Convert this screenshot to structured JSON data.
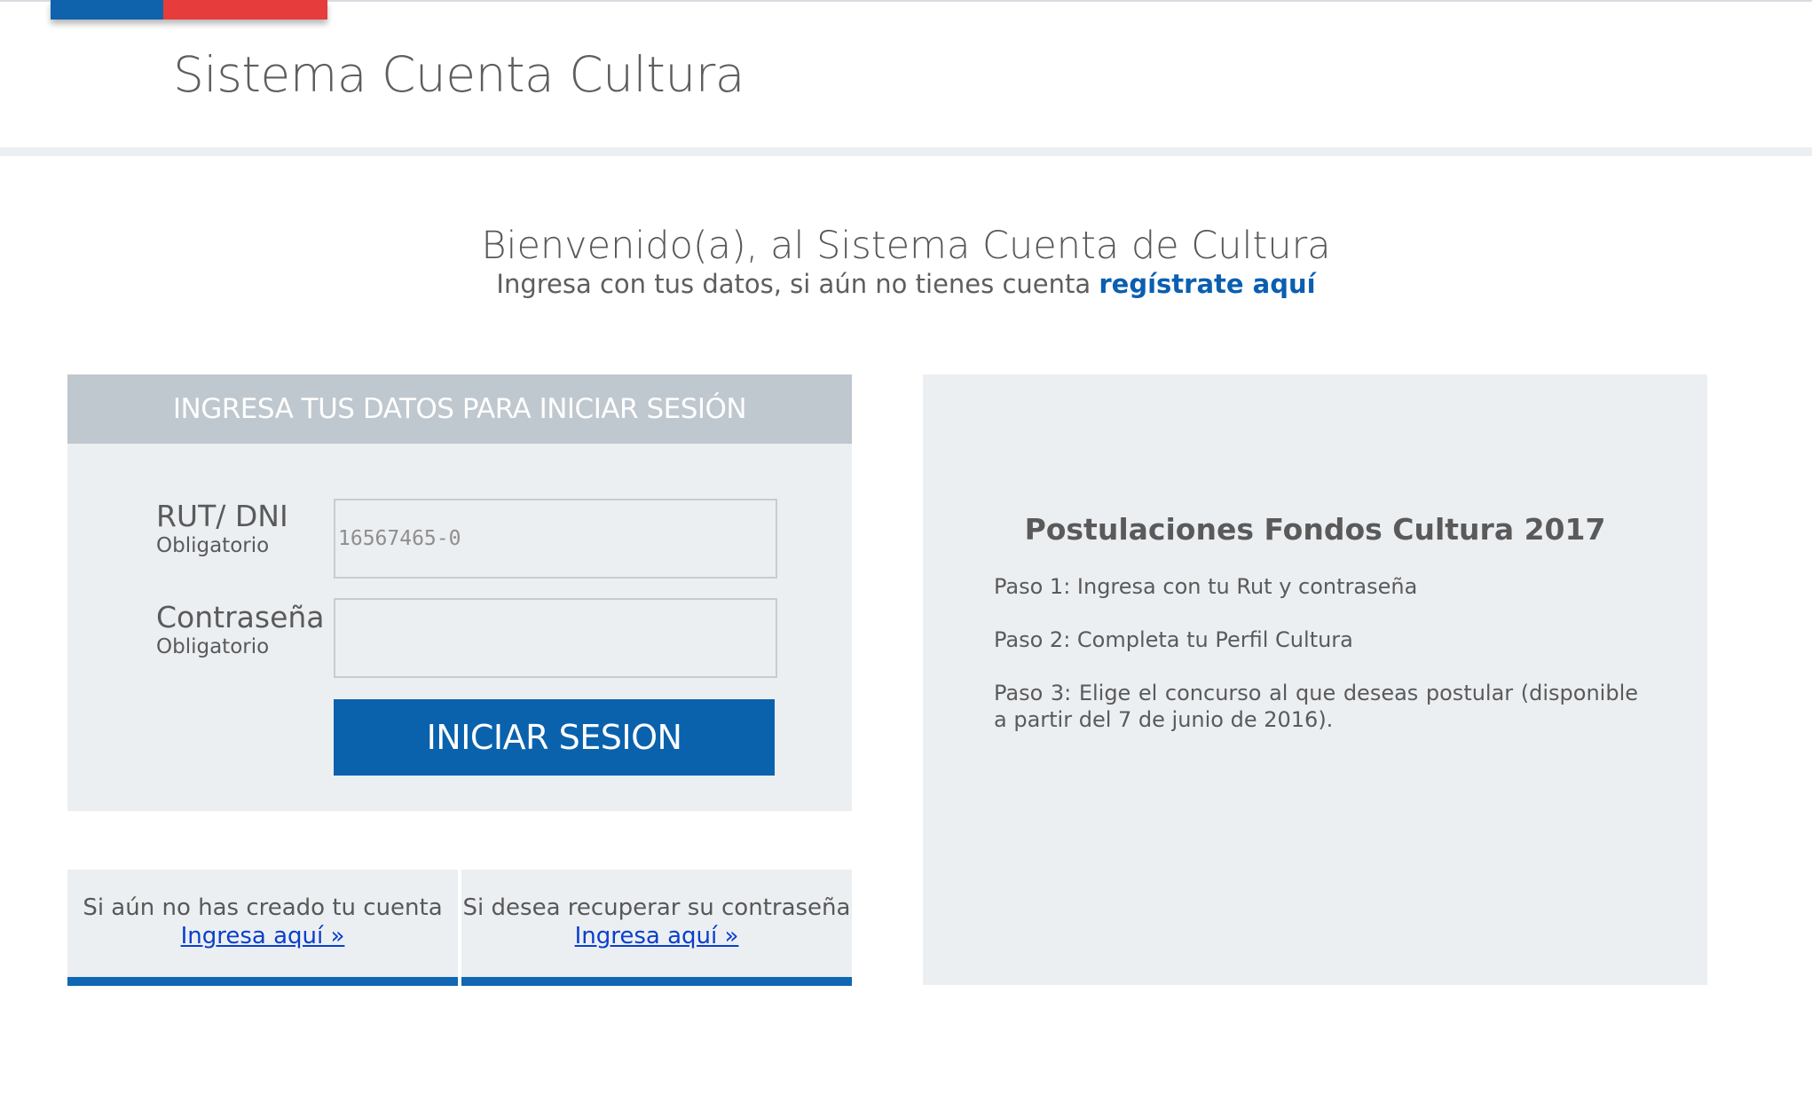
{
  "header": {
    "site_title": "Sistema Cuenta Cultura",
    "flag_colors": {
      "blue": "#0f62ac",
      "red": "#e63c3c"
    }
  },
  "welcome": {
    "title": "Bienvenido(a), al Sistema Cuenta de Cultura",
    "subtitle": "Ingresa con tus datos, si aún no tienes cuenta",
    "register_link": "regístrate aquí"
  },
  "login": {
    "header": "INGRESA TUS DATOS PARA INICIAR SESIÓN",
    "rut_label": "RUT/ DNI",
    "rut_required": "Obligatorio",
    "rut_placeholder": "16567465-0",
    "rut_value": "",
    "password_label": "Contraseña",
    "password_required": "Obligatorio",
    "password_value": "",
    "submit_label": "INICIAR SESION",
    "accent_color": "#0a62ad"
  },
  "links": {
    "create_account_text": "Si aún no has creado tu cuenta",
    "create_account_link": "Ingresa aquí »",
    "recover_password_text": "Si desea recuperar su contraseña",
    "recover_password_link": "Ingresa aquí »"
  },
  "info": {
    "title": "Postulaciones Fondos Cultura 2017",
    "steps": [
      "Paso 1: Ingresa con tu Rut y contraseña",
      "Paso 2: Completa tu Perfil Cultura",
      "Paso 3: Elige el concurso al que deseas postular (disponible a partir del 7 de junio de 2016)."
    ]
  }
}
